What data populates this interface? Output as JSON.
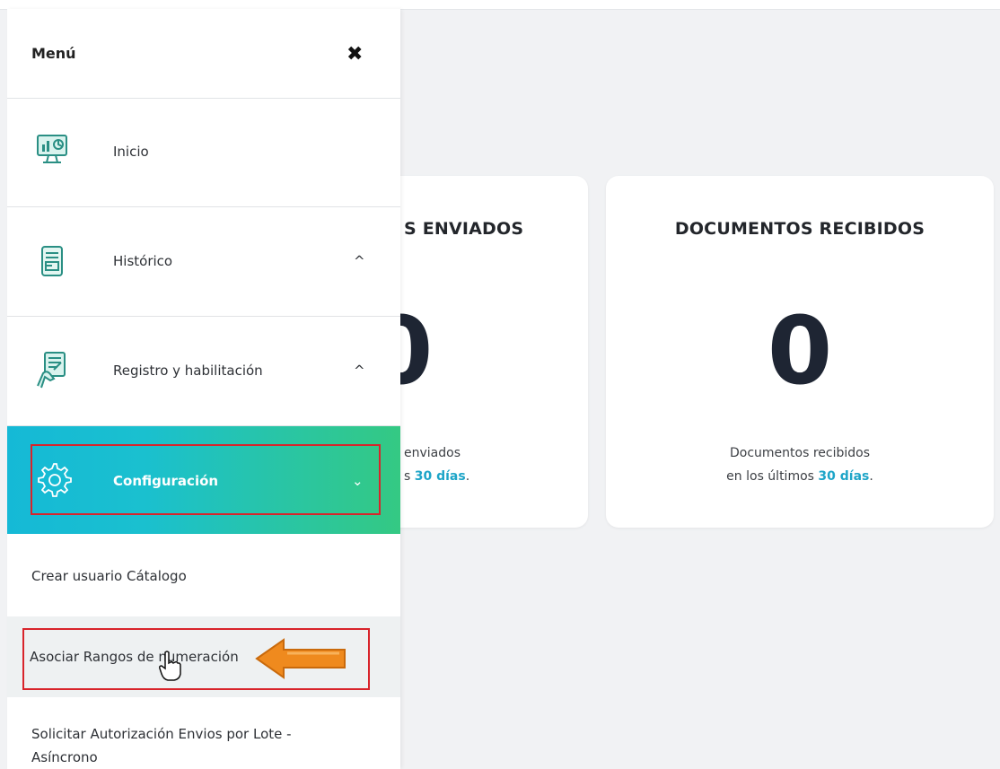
{
  "menu": {
    "title": "Menú",
    "close_icon": "close-icon",
    "items": [
      {
        "label": "Inicio",
        "icon": "monitor-chart-icon"
      },
      {
        "label": "Histórico",
        "icon": "document-icon",
        "chevron": "^"
      },
      {
        "label": "Registro y habilitación",
        "icon": "hand-form-icon",
        "chevron": "^"
      },
      {
        "label": "Configuración",
        "icon": "gear-icon",
        "chevron": "⌄",
        "active": true
      }
    ],
    "subitems": [
      {
        "label": "Crear usuario Cátalogo"
      },
      {
        "label": "Asociar Rangos de numeración"
      },
      {
        "label": "Solicitar Autorización Envios por Lote - Asíncrono"
      }
    ]
  },
  "cards": {
    "sent": {
      "title": "S ENVIADOS",
      "count": "0",
      "desc_line1": "enviados",
      "desc_prefix": "s ",
      "desc_days": "30 días",
      "desc_suffix": "."
    },
    "received": {
      "title": "DOCUMENTOS RECIBIDOS",
      "count": "0",
      "desc_line1": "Documentos recibidos",
      "desc_prefix": "en los últimos ",
      "desc_days": "30 días",
      "desc_suffix": "."
    }
  },
  "colors": {
    "accent": "#1ea5c8",
    "active_gradient_start": "#15b9d6",
    "active_gradient_end": "#34c983",
    "highlight_border": "#d8242b",
    "arrow": "#ef8a1e"
  }
}
